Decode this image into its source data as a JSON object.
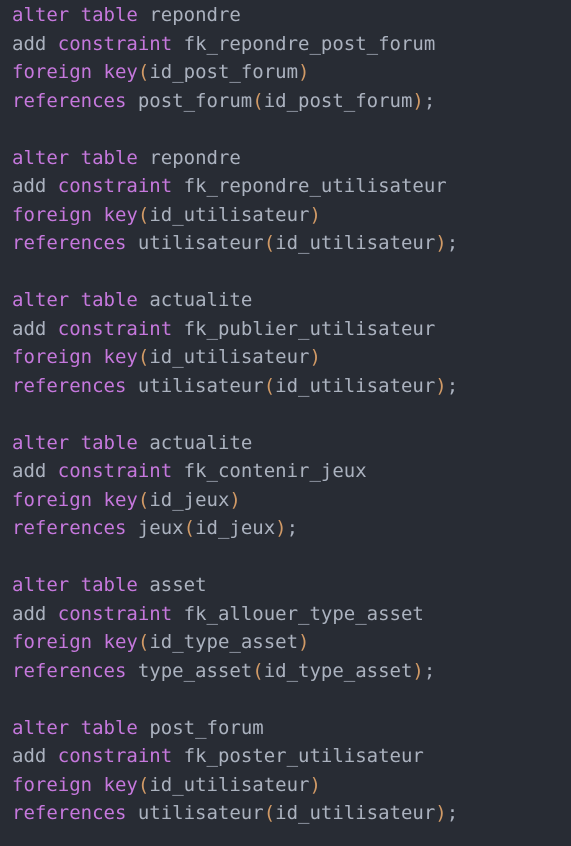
{
  "colors": {
    "background": "#282c34",
    "keyword": "#c678dd",
    "identifier": "#abb2bf",
    "paren": "#d19a66"
  },
  "keywords": {
    "alter": "alter",
    "table": "table",
    "add": "add",
    "constraint": "constraint",
    "foreign": "foreign",
    "key": "key",
    "references": "references"
  },
  "statements": [
    {
      "table": "repondre",
      "constraint": "fk_repondre_post_forum",
      "fk_column": "id_post_forum",
      "ref_table": "post_forum",
      "ref_column": "id_post_forum"
    },
    {
      "table": "repondre",
      "constraint": "fk_repondre_utilisateur",
      "fk_column": "id_utilisateur",
      "ref_table": "utilisateur",
      "ref_column": "id_utilisateur"
    },
    {
      "table": "actualite",
      "constraint": "fk_publier_utilisateur",
      "fk_column": "id_utilisateur",
      "ref_table": "utilisateur",
      "ref_column": "id_utilisateur"
    },
    {
      "table": "actualite",
      "constraint": "fk_contenir_jeux",
      "fk_column": "id_jeux",
      "ref_table": "jeux",
      "ref_column": "id_jeux"
    },
    {
      "table": "asset",
      "constraint": "fk_allouer_type_asset",
      "fk_column": "id_type_asset",
      "ref_table": "type_asset",
      "ref_column": "id_type_asset"
    },
    {
      "table": "post_forum",
      "constraint": "fk_poster_utilisateur",
      "fk_column": "id_utilisateur",
      "ref_table": "utilisateur",
      "ref_column": "id_utilisateur"
    }
  ]
}
